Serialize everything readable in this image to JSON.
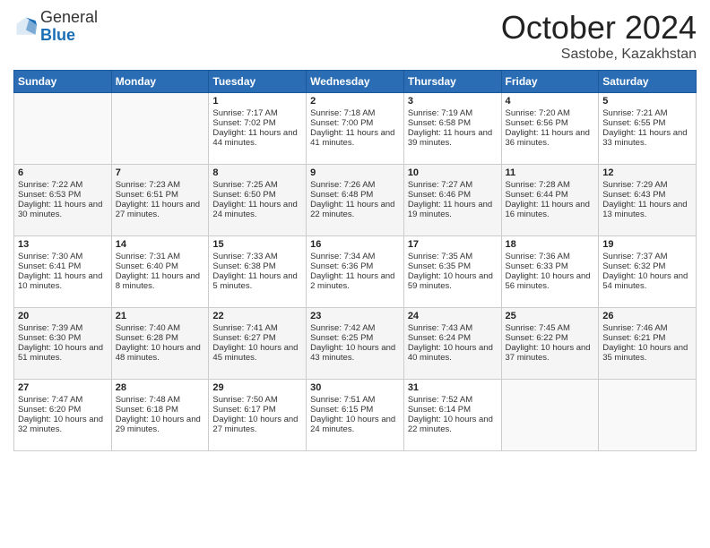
{
  "header": {
    "logo": {
      "general": "General",
      "blue": "Blue"
    },
    "title": "October 2024",
    "location": "Sastobe, Kazakhstan"
  },
  "days_of_week": [
    "Sunday",
    "Monday",
    "Tuesday",
    "Wednesday",
    "Thursday",
    "Friday",
    "Saturday"
  ],
  "weeks": [
    [
      null,
      null,
      {
        "day": 1,
        "sunrise": "Sunrise: 7:17 AM",
        "sunset": "Sunset: 7:02 PM",
        "daylight": "Daylight: 11 hours and 44 minutes."
      },
      {
        "day": 2,
        "sunrise": "Sunrise: 7:18 AM",
        "sunset": "Sunset: 7:00 PM",
        "daylight": "Daylight: 11 hours and 41 minutes."
      },
      {
        "day": 3,
        "sunrise": "Sunrise: 7:19 AM",
        "sunset": "Sunset: 6:58 PM",
        "daylight": "Daylight: 11 hours and 39 minutes."
      },
      {
        "day": 4,
        "sunrise": "Sunrise: 7:20 AM",
        "sunset": "Sunset: 6:56 PM",
        "daylight": "Daylight: 11 hours and 36 minutes."
      },
      {
        "day": 5,
        "sunrise": "Sunrise: 7:21 AM",
        "sunset": "Sunset: 6:55 PM",
        "daylight": "Daylight: 11 hours and 33 minutes."
      }
    ],
    [
      {
        "day": 6,
        "sunrise": "Sunrise: 7:22 AM",
        "sunset": "Sunset: 6:53 PM",
        "daylight": "Daylight: 11 hours and 30 minutes."
      },
      {
        "day": 7,
        "sunrise": "Sunrise: 7:23 AM",
        "sunset": "Sunset: 6:51 PM",
        "daylight": "Daylight: 11 hours and 27 minutes."
      },
      {
        "day": 8,
        "sunrise": "Sunrise: 7:25 AM",
        "sunset": "Sunset: 6:50 PM",
        "daylight": "Daylight: 11 hours and 24 minutes."
      },
      {
        "day": 9,
        "sunrise": "Sunrise: 7:26 AM",
        "sunset": "Sunset: 6:48 PM",
        "daylight": "Daylight: 11 hours and 22 minutes."
      },
      {
        "day": 10,
        "sunrise": "Sunrise: 7:27 AM",
        "sunset": "Sunset: 6:46 PM",
        "daylight": "Daylight: 11 hours and 19 minutes."
      },
      {
        "day": 11,
        "sunrise": "Sunrise: 7:28 AM",
        "sunset": "Sunset: 6:44 PM",
        "daylight": "Daylight: 11 hours and 16 minutes."
      },
      {
        "day": 12,
        "sunrise": "Sunrise: 7:29 AM",
        "sunset": "Sunset: 6:43 PM",
        "daylight": "Daylight: 11 hours and 13 minutes."
      }
    ],
    [
      {
        "day": 13,
        "sunrise": "Sunrise: 7:30 AM",
        "sunset": "Sunset: 6:41 PM",
        "daylight": "Daylight: 11 hours and 10 minutes."
      },
      {
        "day": 14,
        "sunrise": "Sunrise: 7:31 AM",
        "sunset": "Sunset: 6:40 PM",
        "daylight": "Daylight: 11 hours and 8 minutes."
      },
      {
        "day": 15,
        "sunrise": "Sunrise: 7:33 AM",
        "sunset": "Sunset: 6:38 PM",
        "daylight": "Daylight: 11 hours and 5 minutes."
      },
      {
        "day": 16,
        "sunrise": "Sunrise: 7:34 AM",
        "sunset": "Sunset: 6:36 PM",
        "daylight": "Daylight: 11 hours and 2 minutes."
      },
      {
        "day": 17,
        "sunrise": "Sunrise: 7:35 AM",
        "sunset": "Sunset: 6:35 PM",
        "daylight": "Daylight: 10 hours and 59 minutes."
      },
      {
        "day": 18,
        "sunrise": "Sunrise: 7:36 AM",
        "sunset": "Sunset: 6:33 PM",
        "daylight": "Daylight: 10 hours and 56 minutes."
      },
      {
        "day": 19,
        "sunrise": "Sunrise: 7:37 AM",
        "sunset": "Sunset: 6:32 PM",
        "daylight": "Daylight: 10 hours and 54 minutes."
      }
    ],
    [
      {
        "day": 20,
        "sunrise": "Sunrise: 7:39 AM",
        "sunset": "Sunset: 6:30 PM",
        "daylight": "Daylight: 10 hours and 51 minutes."
      },
      {
        "day": 21,
        "sunrise": "Sunrise: 7:40 AM",
        "sunset": "Sunset: 6:28 PM",
        "daylight": "Daylight: 10 hours and 48 minutes."
      },
      {
        "day": 22,
        "sunrise": "Sunrise: 7:41 AM",
        "sunset": "Sunset: 6:27 PM",
        "daylight": "Daylight: 10 hours and 45 minutes."
      },
      {
        "day": 23,
        "sunrise": "Sunrise: 7:42 AM",
        "sunset": "Sunset: 6:25 PM",
        "daylight": "Daylight: 10 hours and 43 minutes."
      },
      {
        "day": 24,
        "sunrise": "Sunrise: 7:43 AM",
        "sunset": "Sunset: 6:24 PM",
        "daylight": "Daylight: 10 hours and 40 minutes."
      },
      {
        "day": 25,
        "sunrise": "Sunrise: 7:45 AM",
        "sunset": "Sunset: 6:22 PM",
        "daylight": "Daylight: 10 hours and 37 minutes."
      },
      {
        "day": 26,
        "sunrise": "Sunrise: 7:46 AM",
        "sunset": "Sunset: 6:21 PM",
        "daylight": "Daylight: 10 hours and 35 minutes."
      }
    ],
    [
      {
        "day": 27,
        "sunrise": "Sunrise: 7:47 AM",
        "sunset": "Sunset: 6:20 PM",
        "daylight": "Daylight: 10 hours and 32 minutes."
      },
      {
        "day": 28,
        "sunrise": "Sunrise: 7:48 AM",
        "sunset": "Sunset: 6:18 PM",
        "daylight": "Daylight: 10 hours and 29 minutes."
      },
      {
        "day": 29,
        "sunrise": "Sunrise: 7:50 AM",
        "sunset": "Sunset: 6:17 PM",
        "daylight": "Daylight: 10 hours and 27 minutes."
      },
      {
        "day": 30,
        "sunrise": "Sunrise: 7:51 AM",
        "sunset": "Sunset: 6:15 PM",
        "daylight": "Daylight: 10 hours and 24 minutes."
      },
      {
        "day": 31,
        "sunrise": "Sunrise: 7:52 AM",
        "sunset": "Sunset: 6:14 PM",
        "daylight": "Daylight: 10 hours and 22 minutes."
      },
      null,
      null
    ]
  ]
}
